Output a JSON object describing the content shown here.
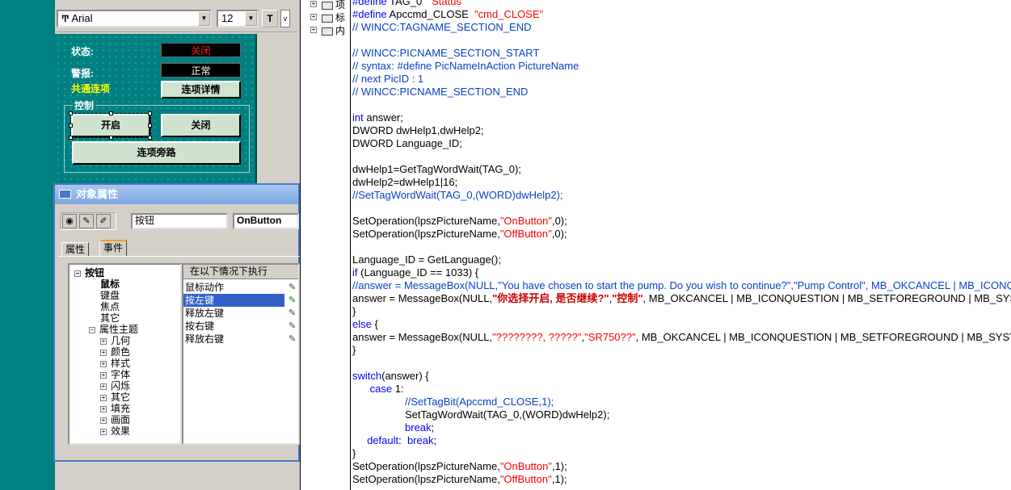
{
  "toolbar": {
    "font_name": "Arial",
    "font_size": "12"
  },
  "canvas": {
    "status_label": "状态:",
    "status_value": "关闭",
    "alarm_label": "警报:",
    "alarm_value": "正常",
    "interlock_label": "共通连项",
    "interlock_details_button": "连项详情",
    "control_group_label": "控制",
    "open_button": "开启",
    "close_button": "关闭",
    "interlock_bypass_button": "连项旁路"
  },
  "properties": {
    "title": "对象属性",
    "object_type": "按钮",
    "object_name": "OnButton",
    "tabs": [
      "属性",
      "事件"
    ],
    "active_tab": "事件",
    "tree": [
      {
        "label": "按钮",
        "level": 0,
        "expander": "−",
        "bold": true
      },
      {
        "label": "鼠标",
        "level": 1,
        "expander": "",
        "bold": true
      },
      {
        "label": "键盘",
        "level": 1,
        "expander": "",
        "bold": false
      },
      {
        "label": "焦点",
        "level": 1,
        "expander": "",
        "bold": false
      },
      {
        "label": "其它",
        "level": 1,
        "expander": "",
        "bold": false
      },
      {
        "label": "属性主题",
        "level": 1,
        "expander": "−",
        "bold": false
      },
      {
        "label": "几何",
        "level": 2,
        "expander": "+",
        "bold": false
      },
      {
        "label": "颜色",
        "level": 2,
        "expander": "+",
        "bold": false
      },
      {
        "label": "样式",
        "level": 2,
        "expander": "+",
        "bold": false
      },
      {
        "label": "字体",
        "level": 2,
        "expander": "+",
        "bold": false
      },
      {
        "label": "闪烁",
        "level": 2,
        "expander": "+",
        "bold": false
      },
      {
        "label": "其它",
        "level": 2,
        "expander": "+",
        "bold": false
      },
      {
        "label": "填充",
        "level": 2,
        "expander": "+",
        "bold": false
      },
      {
        "label": "画面",
        "level": 2,
        "expander": "+",
        "bold": false
      },
      {
        "label": "效果",
        "level": 2,
        "expander": "+",
        "bold": false
      }
    ],
    "events_header": "在以下情况下执行",
    "events": [
      {
        "label": "鼠标动作",
        "selected": false,
        "action": false
      },
      {
        "label": "按左键",
        "selected": true,
        "action": true
      },
      {
        "label": "释放左键",
        "selected": false,
        "action": false
      },
      {
        "label": "按右键",
        "selected": false,
        "action": false
      },
      {
        "label": "释放右键",
        "selected": false,
        "action": false
      }
    ]
  },
  "code_tree": {
    "items": [
      "项",
      "标",
      "内"
    ]
  },
  "code_lines": [
    [
      {
        "t": "#define ",
        "c": "kw"
      },
      {
        "t": "TAG_0  ",
        "c": ""
      },
      {
        "t": "\"Status\"",
        "c": "str"
      }
    ],
    [
      {
        "t": "#define ",
        "c": "kw"
      },
      {
        "t": "Apccmd_CLOSE  ",
        "c": ""
      },
      {
        "t": "\"cmd_CLOSE\"",
        "c": "str"
      }
    ],
    [
      {
        "t": "// WINCC:TAGNAME_SECTION_END",
        "c": "cm"
      }
    ],
    [],
    [
      {
        "t": "// WINCC:PICNAME_SECTION_START",
        "c": "cm"
      }
    ],
    [
      {
        "t": "// syntax: #define PicNameInAction PictureName",
        "c": "cm"
      }
    ],
    [
      {
        "t": "// next PicID : 1",
        "c": "cm"
      }
    ],
    [
      {
        "t": "// WINCC:PICNAME_SECTION_END",
        "c": "cm"
      }
    ],
    [],
    [
      {
        "t": "int ",
        "c": "kw"
      },
      {
        "t": "answer;",
        "c": ""
      }
    ],
    [
      {
        "t": "DWORD dwHelp1,dwHelp2;",
        "c": ""
      }
    ],
    [
      {
        "t": "DWORD Language_ID;",
        "c": ""
      }
    ],
    [],
    [
      {
        "t": "dwHelp1=GetTagWordWait(TAG_0);",
        "c": ""
      }
    ],
    [
      {
        "t": "dwHelp2=dwHelp1|16;",
        "c": ""
      }
    ],
    [
      {
        "t": "//SetTagWordWait(TAG_0,(WORD)dwHelp2);",
        "c": "cm"
      }
    ],
    [],
    [
      {
        "t": "SetOperation(lpszPictureName,",
        "c": ""
      },
      {
        "t": "\"OnButton\"",
        "c": "str"
      },
      {
        "t": ",0);",
        "c": ""
      }
    ],
    [
      {
        "t": "SetOperation(lpszPictureName,",
        "c": ""
      },
      {
        "t": "\"OffButton\"",
        "c": "str"
      },
      {
        "t": ",0);",
        "c": ""
      }
    ],
    [],
    [
      {
        "t": "Language_ID = GetLanguage();",
        "c": ""
      }
    ],
    [
      {
        "t": "if ",
        "c": "kw"
      },
      {
        "t": "(Language_ID == 1033) {",
        "c": ""
      }
    ],
    [
      {
        "t": "//answer = MessageBox(NULL,\"You have chosen to start the pump. Do you wish to continue?\",\"Pump Control\", MB_OKCANCEL | MB_ICONQUESTION",
        "c": "cm"
      }
    ],
    [
      {
        "t": "answer = MessageBox(NULL,",
        "c": ""
      },
      {
        "t": "\"你选择开启, 是否继续?\"",
        "c": "cstr"
      },
      {
        "t": ",",
        "c": ""
      },
      {
        "t": "\"控制\"",
        "c": "cstr"
      },
      {
        "t": ", MB_OKCANCEL | MB_ICONQUESTION | MB_SETFOREGROUND | MB_SYSTEMMODAL);",
        "c": ""
      }
    ],
    [
      {
        "t": "}",
        "c": ""
      }
    ],
    [
      {
        "t": "else ",
        "c": "kw"
      },
      {
        "t": "{",
        "c": ""
      }
    ],
    [
      {
        "t": "answer = MessageBox(NULL,",
        "c": ""
      },
      {
        "t": "\"????????, ?????\"",
        "c": "str"
      },
      {
        "t": ",",
        "c": ""
      },
      {
        "t": "\"SR750??\"",
        "c": "str"
      },
      {
        "t": ", MB_OKCANCEL | MB_ICONQUESTION | MB_SETFOREGROUND | MB_SYSTEMMODAL);",
        "c": ""
      }
    ],
    [
      {
        "t": "}",
        "c": ""
      }
    ],
    [],
    [
      {
        "t": "switch",
        "c": "kw"
      },
      {
        "t": "(answer) {",
        "c": ""
      }
    ],
    [
      {
        "t": "      ",
        "c": ""
      },
      {
        "t": "case ",
        "c": "kw"
      },
      {
        "t": "1:",
        "c": ""
      }
    ],
    [
      {
        "t": "                  //SetTagBit(Apccmd_CLOSE,1);",
        "c": "cm"
      }
    ],
    [
      {
        "t": "                  SetTagWordWait(TAG_0,(WORD)dwHelp2);",
        "c": ""
      }
    ],
    [
      {
        "t": "                  ",
        "c": ""
      },
      {
        "t": "break",
        "c": "kw"
      },
      {
        "t": ";",
        "c": ""
      }
    ],
    [
      {
        "t": "     ",
        "c": ""
      },
      {
        "t": "default",
        "c": "kw"
      },
      {
        "t": ":  ",
        "c": ""
      },
      {
        "t": "break",
        "c": "kw"
      },
      {
        "t": ";",
        "c": ""
      }
    ],
    [
      {
        "t": "}",
        "c": ""
      }
    ],
    [
      {
        "t": "SetOperation(lpszPictureName,",
        "c": ""
      },
      {
        "t": "\"OnButton\"",
        "c": "str"
      },
      {
        "t": ",1);",
        "c": ""
      }
    ],
    [
      {
        "t": "SetOperation(lpszPictureName,",
        "c": ""
      },
      {
        "t": "\"OffButton\"",
        "c": "str"
      },
      {
        "t": ",1);",
        "c": ""
      }
    ]
  ]
}
